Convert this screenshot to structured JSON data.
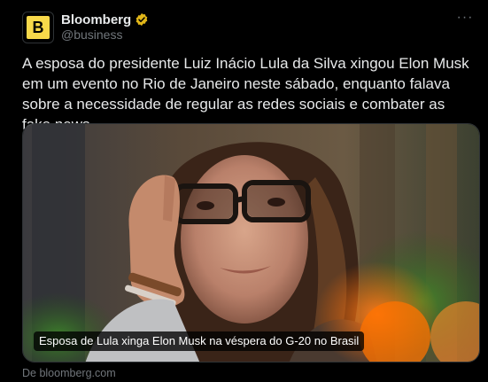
{
  "author": {
    "display_name": "Bloomberg",
    "handle": "@business",
    "avatar_letter": "B",
    "avatar_color": "#f8d94a",
    "verified_color": "#e2b719"
  },
  "menu": {
    "more_label": "···"
  },
  "tweet": {
    "text": "A esposa do presidente Luiz Inácio Lula da Silva xingou Elon Musk em um evento no Rio de Janeiro neste sábado, enquanto falava sobre a necessidade de regular as redes sociais e combater as fake news"
  },
  "card": {
    "caption": "Esposa de Lula xinga Elon Musk na véspera do G-20 no Brasil",
    "source": "De bloomberg.com"
  },
  "colors": {
    "background": "#000000",
    "text": "#e7e9ea",
    "secondary": "#71767b",
    "border": "#2f3336"
  }
}
